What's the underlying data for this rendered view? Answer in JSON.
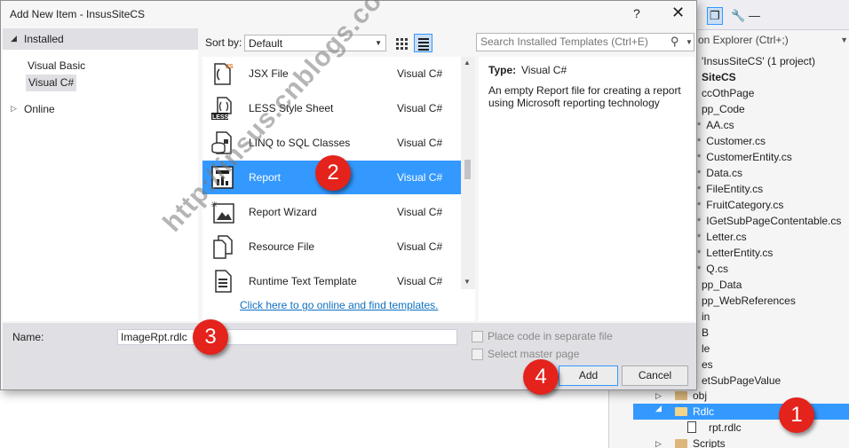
{
  "dialog": {
    "title": "Add New Item - InsusSiteCS",
    "help_label": "?",
    "close_label": "✕"
  },
  "left_pane": {
    "installed_label": "Installed",
    "items": [
      "Visual Basic",
      "Visual C#"
    ],
    "selected_item": "Visual C#",
    "online_label": "Online"
  },
  "toolbar": {
    "sort_label": "Sort by:",
    "sort_value": "Default",
    "search_placeholder": "Search Installed Templates (Ctrl+E)",
    "active_view": "list"
  },
  "templates": [
    {
      "name": "JSX File",
      "language": "Visual C#",
      "icon": "jsx-file-icon"
    },
    {
      "name": "LESS Style Sheet",
      "language": "Visual C#",
      "icon": "less-file-icon"
    },
    {
      "name": "LINQ to SQL Classes",
      "language": "Visual C#",
      "icon": "linq-to-sql-icon"
    },
    {
      "name": "Report",
      "language": "Visual C#",
      "icon": "report-icon",
      "selected": true
    },
    {
      "name": "Report Wizard",
      "language": "Visual C#",
      "icon": "report-wizard-icon"
    },
    {
      "name": "Resource File",
      "language": "Visual C#",
      "icon": "resource-file-icon"
    },
    {
      "name": "Runtime Text Template",
      "language": "Visual C#",
      "icon": "text-template-icon"
    }
  ],
  "online_link": "Click here to go online and find templates.",
  "details": {
    "type_label": "Type:",
    "type_value": "Visual C#",
    "description": "An empty Report file for creating a report using Microsoft reporting technology"
  },
  "bottom": {
    "name_label": "Name:",
    "name_value": "ImageRpt.rdlc",
    "place_code_label": "Place code in separate file",
    "select_master_label": "Select master page",
    "add_label": "Add",
    "cancel_label": "Cancel"
  },
  "badges": [
    "1",
    "2",
    "3",
    "4"
  ],
  "watermark": "http://insus.cnblogs.com",
  "solution_explorer": {
    "search_placeholder": "on Explorer (Ctrl+;)",
    "rows": [
      {
        "text": "'InsusSiteCS' (1 project)",
        "star": false,
        "bold": false
      },
      {
        "text": "SiteCS",
        "star": false,
        "bold": true
      },
      {
        "text": "ccOthPage",
        "star": false,
        "bold": false
      },
      {
        "text": "pp_Code",
        "star": false,
        "bold": false
      },
      {
        "text": "AA.cs",
        "star": true,
        "bold": false
      },
      {
        "text": "Customer.cs",
        "star": true,
        "bold": false
      },
      {
        "text": "CustomerEntity.cs",
        "star": true,
        "bold": false
      },
      {
        "text": "Data.cs",
        "star": true,
        "bold": false
      },
      {
        "text": "FileEntity.cs",
        "star": true,
        "bold": false
      },
      {
        "text": "FruitCategory.cs",
        "star": true,
        "bold": false
      },
      {
        "text": "IGetSubPageContentable.cs",
        "star": true,
        "bold": false
      },
      {
        "text": "Letter.cs",
        "star": true,
        "bold": false
      },
      {
        "text": "LetterEntity.cs",
        "star": true,
        "bold": false
      },
      {
        "text": "Q.cs",
        "star": true,
        "bold": false
      },
      {
        "text": "pp_Data",
        "star": false,
        "bold": false
      },
      {
        "text": "pp_WebReferences",
        "star": false,
        "bold": false
      },
      {
        "text": "in",
        "star": false,
        "bold": false
      },
      {
        "text": "B",
        "star": false,
        "bold": false
      },
      {
        "text": "le",
        "star": false,
        "bold": false
      },
      {
        "text": "es",
        "star": false,
        "bold": false
      },
      {
        "text": "etSubPageValue",
        "star": false,
        "bold": false
      }
    ],
    "obj_label": "obj",
    "rdlc_label": "Rdlc",
    "rpt_label": "rpt.rdlc",
    "scripts_label": "Scripts"
  },
  "colors": {
    "selection": "#3399ff",
    "badge": "#e3231c",
    "link": "#0e70c0"
  }
}
